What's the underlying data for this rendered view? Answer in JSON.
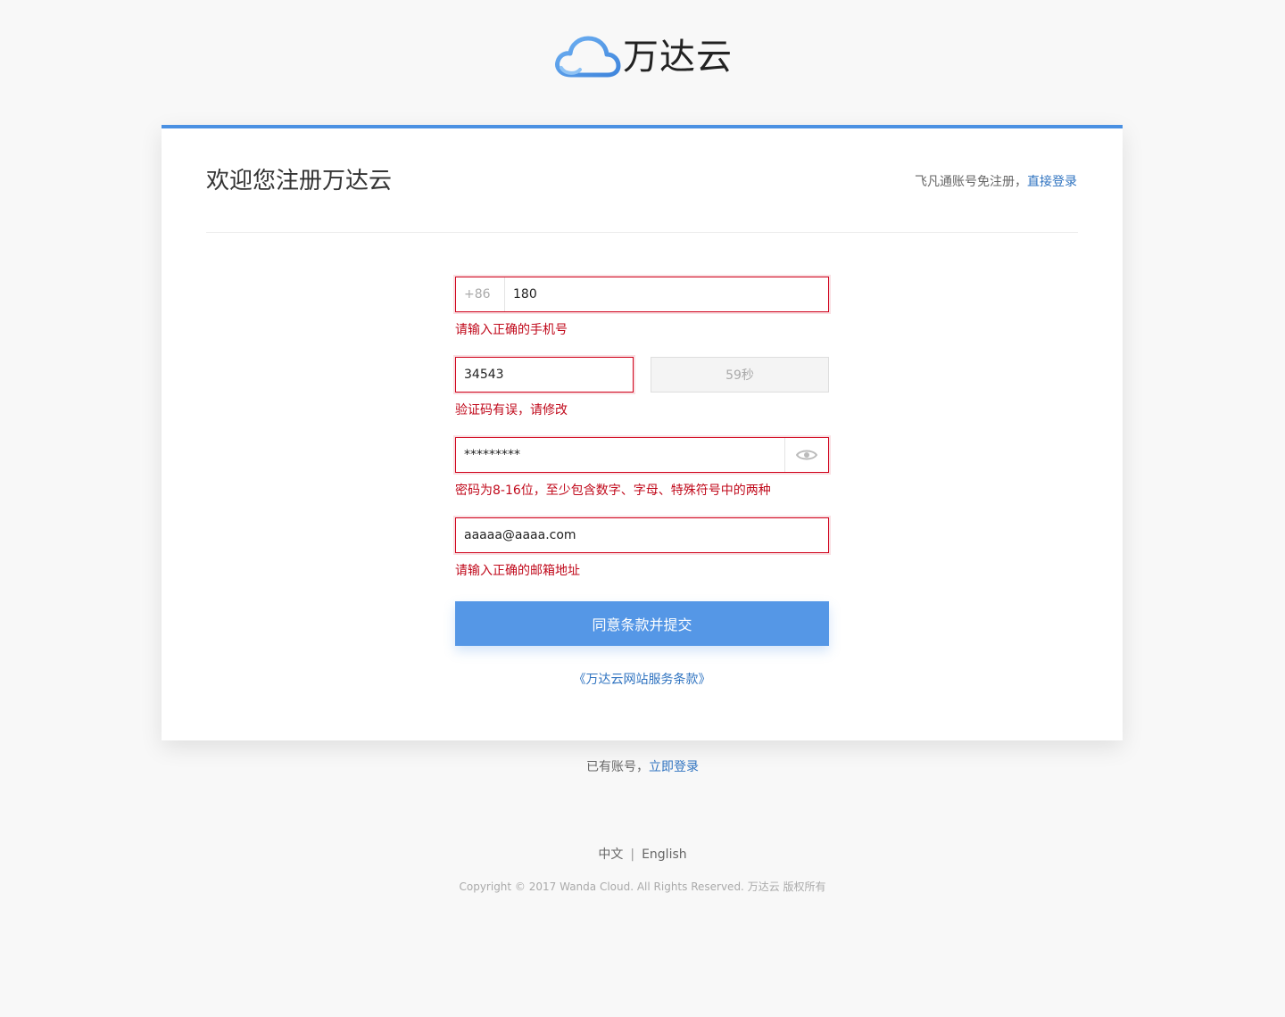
{
  "brand": {
    "name": "万达云",
    "logo_icon": "cloud-icon",
    "accent": "#4a90e2"
  },
  "header": {
    "title": "欢迎您注册万达云",
    "alt_register_text": "飞凡通账号免注册，",
    "direct_login_link": "直接登录"
  },
  "form": {
    "phone": {
      "country_code": "+86",
      "value": "180",
      "error": "请输入正确的手机号"
    },
    "sms_code": {
      "value": "34543",
      "resend_button": "59秒",
      "error": "验证码有误，请修改"
    },
    "password": {
      "value": "*********",
      "toggle_icon": "eye-icon",
      "error": "密码为8-16位，至少包含数字、字母、特殊符号中的两种"
    },
    "email": {
      "value": "aaaaa@aaaa.com",
      "error": "请输入正确的邮箱地址"
    },
    "submit_label": "同意条款并提交",
    "terms_link": "《万达云网站服务条款》"
  },
  "footer": {
    "has_account_text": "已有账号，",
    "login_now_link": "立即登录",
    "lang_zh": "中文",
    "lang_sep": "|",
    "lang_en": "English",
    "copyright": "Copyright © 2017 Wanda Cloud. All Rights Reserved. 万达云 版权所有"
  },
  "colors": {
    "error": "#d0021b",
    "primary_button": "#5597e6",
    "link": "#2f73c0"
  }
}
